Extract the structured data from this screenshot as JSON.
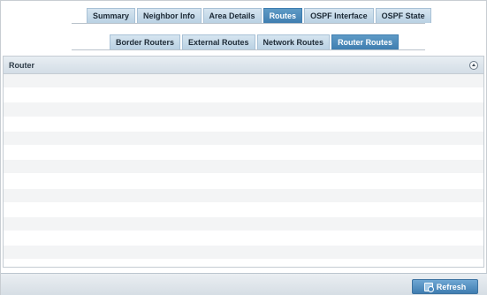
{
  "primary_tabs": [
    {
      "label": "Summary",
      "active": false
    },
    {
      "label": "Neighbor Info",
      "active": false
    },
    {
      "label": "Area Details",
      "active": false
    },
    {
      "label": "Routes",
      "active": true
    },
    {
      "label": "OSPF Interface",
      "active": false
    },
    {
      "label": "OSPF State",
      "active": false
    }
  ],
  "secondary_tabs": [
    {
      "label": "Border Routers",
      "active": false
    },
    {
      "label": "External Routes",
      "active": false
    },
    {
      "label": "Network Routes",
      "active": false
    },
    {
      "label": "Router Routes",
      "active": true
    }
  ],
  "table": {
    "header": "Router",
    "collapse_icon": "collapse-up-icon",
    "rows": [
      "",
      "",
      "",
      "",
      "",
      "",
      "",
      "",
      "",
      "",
      "",
      "",
      ""
    ]
  },
  "footer": {
    "refresh_label": "Refresh",
    "refresh_icon": "refresh-icon"
  },
  "colors": {
    "active_tab": "#3f7eb0",
    "inactive_tab": "#c7dbe9",
    "button": "#4f8dc0"
  }
}
